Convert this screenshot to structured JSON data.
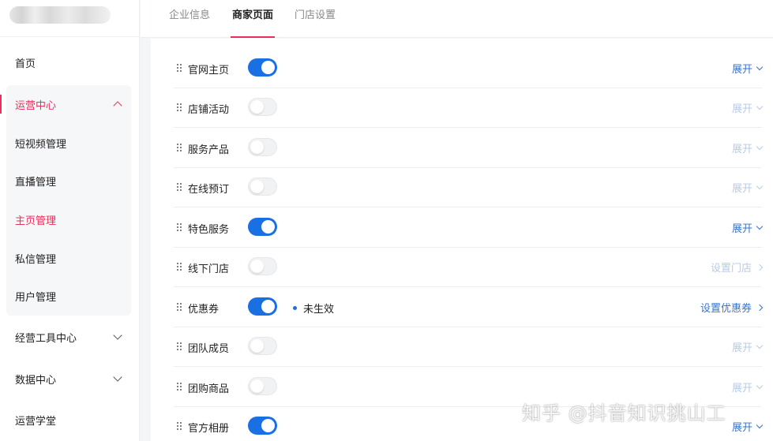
{
  "sidebar": {
    "items": [
      {
        "label": "首页"
      },
      {
        "label": "运营中心"
      },
      {
        "label": "短视频管理"
      },
      {
        "label": "直播管理"
      },
      {
        "label": "主页管理"
      },
      {
        "label": "私信管理"
      },
      {
        "label": "用户管理"
      },
      {
        "label": "经营工具中心"
      },
      {
        "label": "数据中心"
      },
      {
        "label": "运营学堂"
      }
    ]
  },
  "tabs": [
    {
      "label": "企业信息"
    },
    {
      "label": "商家页面"
    },
    {
      "label": "门店设置"
    }
  ],
  "rows": [
    {
      "label": "官网主页",
      "enabled": true,
      "action": "展开"
    },
    {
      "label": "店铺活动",
      "enabled": false,
      "action": "展开"
    },
    {
      "label": "服务产品",
      "enabled": false,
      "action": "展开"
    },
    {
      "label": "在线预订",
      "enabled": false,
      "action": "展开"
    },
    {
      "label": "特色服务",
      "enabled": true,
      "action": "展开"
    },
    {
      "label": "线下门店",
      "enabled": false,
      "action": "设置门店"
    },
    {
      "label": "优惠券",
      "enabled": true,
      "status": "未生效",
      "action": "设置优惠券"
    },
    {
      "label": "团队成员",
      "enabled": false,
      "action": "展开"
    },
    {
      "label": "团购商品",
      "enabled": false,
      "action": "展开"
    },
    {
      "label": "官方相册",
      "enabled": true,
      "action": "展开"
    }
  ],
  "watermark": "知乎 @抖音知识挑山工",
  "colors": {
    "accent": "#e6315a",
    "toggle_on": "#1a6fe3",
    "link": "#3b73c7"
  }
}
